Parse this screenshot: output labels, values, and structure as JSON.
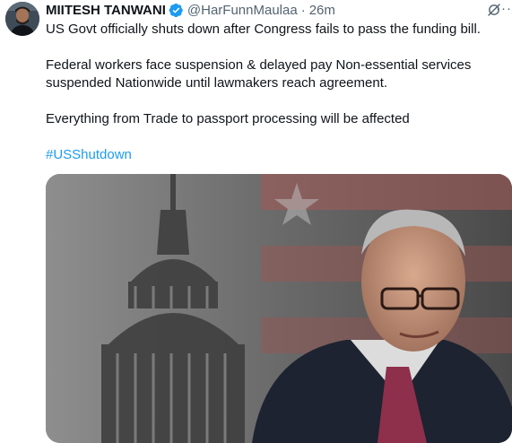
{
  "author": {
    "display_name": "MIITESH TANWANI",
    "handle": "@HarFunnMaulaa",
    "separator": "·",
    "timestamp": "26m",
    "verified_icon": "verified-badge-icon"
  },
  "actions": {
    "grok_icon": "grok-icon",
    "more_label": "···"
  },
  "tweet": {
    "line1": "US Govt officially shuts down after Congress fails to pass the funding bill.",
    "line2": "Federal workers face suspension & delayed pay Non-essential services suspended Nationwide until lawmakers reach agreement.",
    "line3": "Everything from Trade to passport processing will be affected",
    "hashtag": "#USShutdown"
  },
  "colors": {
    "link": "#1d9bf0",
    "verified": "#1d9bf0",
    "secondary_text": "#536471"
  }
}
